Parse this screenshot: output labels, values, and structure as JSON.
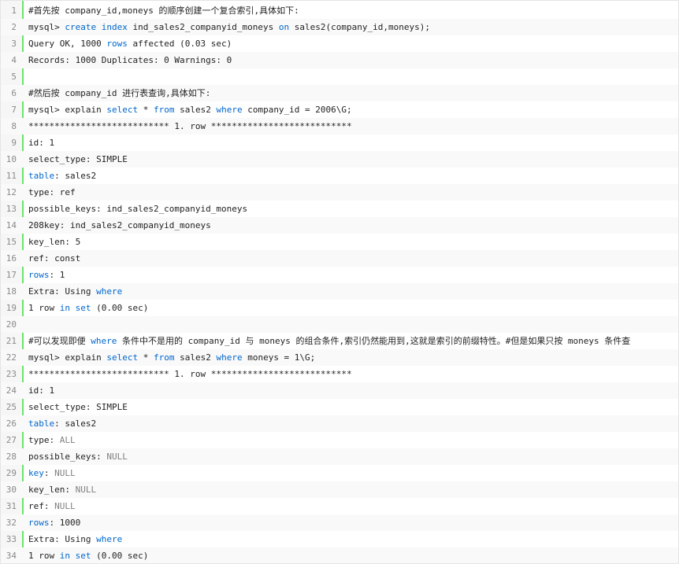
{
  "lines": [
    {
      "n": "1",
      "segs": [
        {
          "t": "#首先按 company_id,moneys 的顺序创建一个复合索引,具体如下:"
        }
      ]
    },
    {
      "n": "2",
      "segs": [
        {
          "t": "mysql> "
        },
        {
          "t": "create index",
          "c": "kw"
        },
        {
          "t": " ind_sales2_companyid_moneys "
        },
        {
          "t": "on",
          "c": "kw"
        },
        {
          "t": " sales2(company_id,moneys);"
        }
      ]
    },
    {
      "n": "3",
      "segs": [
        {
          "t": "Query OK, 1000 "
        },
        {
          "t": "rows",
          "c": "kw"
        },
        {
          "t": " affected (0.03 sec)"
        }
      ]
    },
    {
      "n": "4",
      "segs": [
        {
          "t": "Records: 1000 Duplicates: 0 Warnings: 0"
        }
      ]
    },
    {
      "n": "5",
      "segs": []
    },
    {
      "n": "6",
      "segs": [
        {
          "t": "#然后按 company_id 进行表查询,具体如下:"
        }
      ]
    },
    {
      "n": "7",
      "segs": [
        {
          "t": "mysql> explain "
        },
        {
          "t": "select",
          "c": "kw"
        },
        {
          "t": " * "
        },
        {
          "t": "from",
          "c": "kw"
        },
        {
          "t": " sales2 "
        },
        {
          "t": "where",
          "c": "kw"
        },
        {
          "t": " company_id = 2006\\G;"
        }
      ]
    },
    {
      "n": "8",
      "segs": [
        {
          "t": "*************************** 1. row ***************************"
        }
      ]
    },
    {
      "n": "9",
      "segs": [
        {
          "t": "id: 1"
        }
      ]
    },
    {
      "n": "10",
      "segs": [
        {
          "t": "select_type: SIMPLE"
        }
      ]
    },
    {
      "n": "11",
      "segs": [
        {
          "t": "table",
          "c": "kw"
        },
        {
          "t": ": sales2"
        }
      ]
    },
    {
      "n": "12",
      "segs": [
        {
          "t": "type: ref"
        }
      ]
    },
    {
      "n": "13",
      "segs": [
        {
          "t": "possible_keys: ind_sales2_companyid_moneys"
        }
      ]
    },
    {
      "n": "14",
      "segs": [
        {
          "t": "208key: ind_sales2_companyid_moneys"
        }
      ]
    },
    {
      "n": "15",
      "segs": [
        {
          "t": "key_len: 5"
        }
      ]
    },
    {
      "n": "16",
      "segs": [
        {
          "t": "ref: const"
        }
      ]
    },
    {
      "n": "17",
      "segs": [
        {
          "t": "rows",
          "c": "kw"
        },
        {
          "t": ": 1"
        }
      ]
    },
    {
      "n": "18",
      "segs": [
        {
          "t": "Extra: Using "
        },
        {
          "t": "where",
          "c": "kw"
        }
      ]
    },
    {
      "n": "19",
      "segs": [
        {
          "t": "1 row "
        },
        {
          "t": "in",
          "c": "kw"
        },
        {
          "t": " "
        },
        {
          "t": "set",
          "c": "kw"
        },
        {
          "t": " (0.00 sec)"
        }
      ]
    },
    {
      "n": "20",
      "segs": []
    },
    {
      "n": "21",
      "segs": [
        {
          "t": "#可以发现即便 "
        },
        {
          "t": "where",
          "c": "kw"
        },
        {
          "t": " 条件中不是用的 company_id 与 moneys 的组合条件,索引仍然能用到,这就是索引的前缀特性。#但是如果只按 moneys 条件查"
        }
      ]
    },
    {
      "n": "22",
      "segs": [
        {
          "t": "mysql> explain "
        },
        {
          "t": "select",
          "c": "kw"
        },
        {
          "t": " * "
        },
        {
          "t": "from",
          "c": "kw"
        },
        {
          "t": " sales2 "
        },
        {
          "t": "where",
          "c": "kw"
        },
        {
          "t": " moneys = 1\\G;"
        }
      ]
    },
    {
      "n": "23",
      "segs": [
        {
          "t": "*************************** 1. row ***************************"
        }
      ]
    },
    {
      "n": "24",
      "segs": [
        {
          "t": "id: 1"
        }
      ]
    },
    {
      "n": "25",
      "segs": [
        {
          "t": "select_type: SIMPLE"
        }
      ]
    },
    {
      "n": "26",
      "segs": [
        {
          "t": "table",
          "c": "kw"
        },
        {
          "t": ": sales2"
        }
      ]
    },
    {
      "n": "27",
      "segs": [
        {
          "t": "type: "
        },
        {
          "t": "ALL",
          "c": "gray"
        }
      ]
    },
    {
      "n": "28",
      "segs": [
        {
          "t": "possible_keys: "
        },
        {
          "t": "NULL",
          "c": "gray"
        }
      ]
    },
    {
      "n": "29",
      "segs": [
        {
          "t": "key",
          "c": "kw"
        },
        {
          "t": ": "
        },
        {
          "t": "NULL",
          "c": "gray"
        }
      ]
    },
    {
      "n": "30",
      "segs": [
        {
          "t": "key_len: "
        },
        {
          "t": "NULL",
          "c": "gray"
        }
      ]
    },
    {
      "n": "31",
      "segs": [
        {
          "t": "ref: "
        },
        {
          "t": "NULL",
          "c": "gray"
        }
      ]
    },
    {
      "n": "32",
      "segs": [
        {
          "t": "rows",
          "c": "kw"
        },
        {
          "t": ": 1000"
        }
      ]
    },
    {
      "n": "33",
      "segs": [
        {
          "t": "Extra: Using "
        },
        {
          "t": "where",
          "c": "kw"
        }
      ]
    },
    {
      "n": "34",
      "segs": [
        {
          "t": "1 row "
        },
        {
          "t": "in",
          "c": "kw"
        },
        {
          "t": " "
        },
        {
          "t": "set",
          "c": "kw"
        },
        {
          "t": " (0.00 sec)"
        }
      ]
    }
  ],
  "colors": {
    "keyword": "#0066cc",
    "gutter_accent": "#6ce26c",
    "muted": "#808080"
  }
}
